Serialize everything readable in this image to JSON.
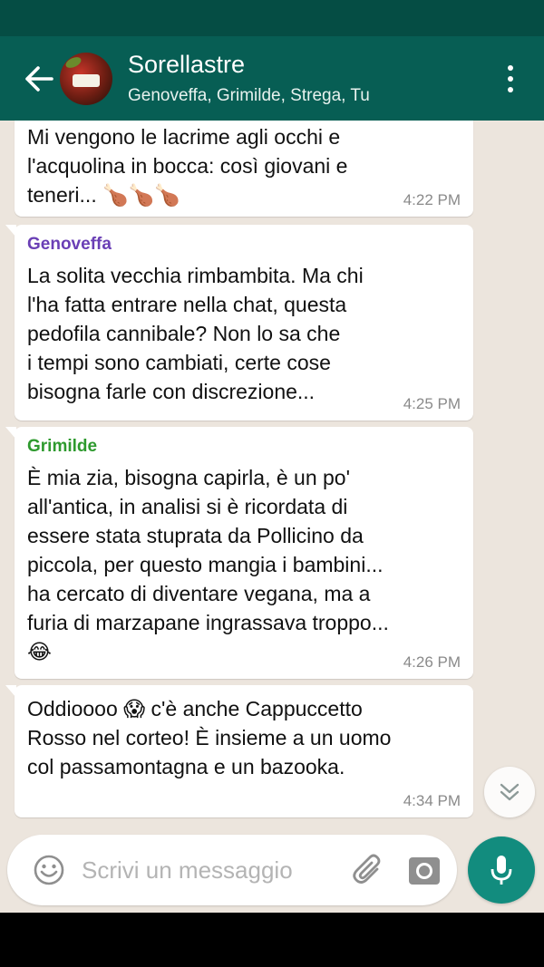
{
  "header": {
    "title": "Sorellastre",
    "subtitle": "Genoveffa, Grimilde, Strega, Tu"
  },
  "messages": [
    {
      "sender": "",
      "text": "Mi vengono le lacrime agli occhi e\nl'acquolina in bocca: così giovani e\nteneri... 🍗🍗🍗",
      "time": "4:22 PM"
    },
    {
      "sender": "Genoveffa",
      "sender_color": "#6a3fb5",
      "text": "La solita vecchia rimbambita. Ma chi\nl'ha fatta entrare nella chat, questa\npedofila cannibale? Non lo sa che\ni tempi sono cambiati, certe cose\nbisogna farle con discrezione...",
      "time": "4:25 PM"
    },
    {
      "sender": "Grimilde",
      "sender_color": "#2e9a2e",
      "text": "È mia zia, bisogna capirla, è un po'\nall'antica, in analisi si è ricordata di\nessere stata stuprata da Pollicino da\npiccola, per questo mangia i bambini...\nha cercato di diventare vegana, ma a\nfuria di marzapane ingrassava troppo...\n😂",
      "time": "4:26 PM"
    },
    {
      "sender": "",
      "text": "Oddioooo 😱 c'è anche Cappuccetto\nRosso nel corteo! È insieme a un uomo\ncol passamontagna e un bazooka.",
      "time": "4:34 PM"
    }
  ],
  "composer": {
    "placeholder": "Scrivi un messaggio"
  },
  "icons": {
    "back": "arrow-left-icon",
    "menu": "more-vert-icon",
    "emoji": "smiley-icon",
    "attach": "paperclip-icon",
    "camera": "camera-icon",
    "mic": "microphone-icon",
    "scroll": "chevron-double-down-icon"
  },
  "colors": {
    "header": "#075e54",
    "status_bar": "#054d44",
    "accent": "#128c7e",
    "chat_bg": "#ece5dd"
  }
}
